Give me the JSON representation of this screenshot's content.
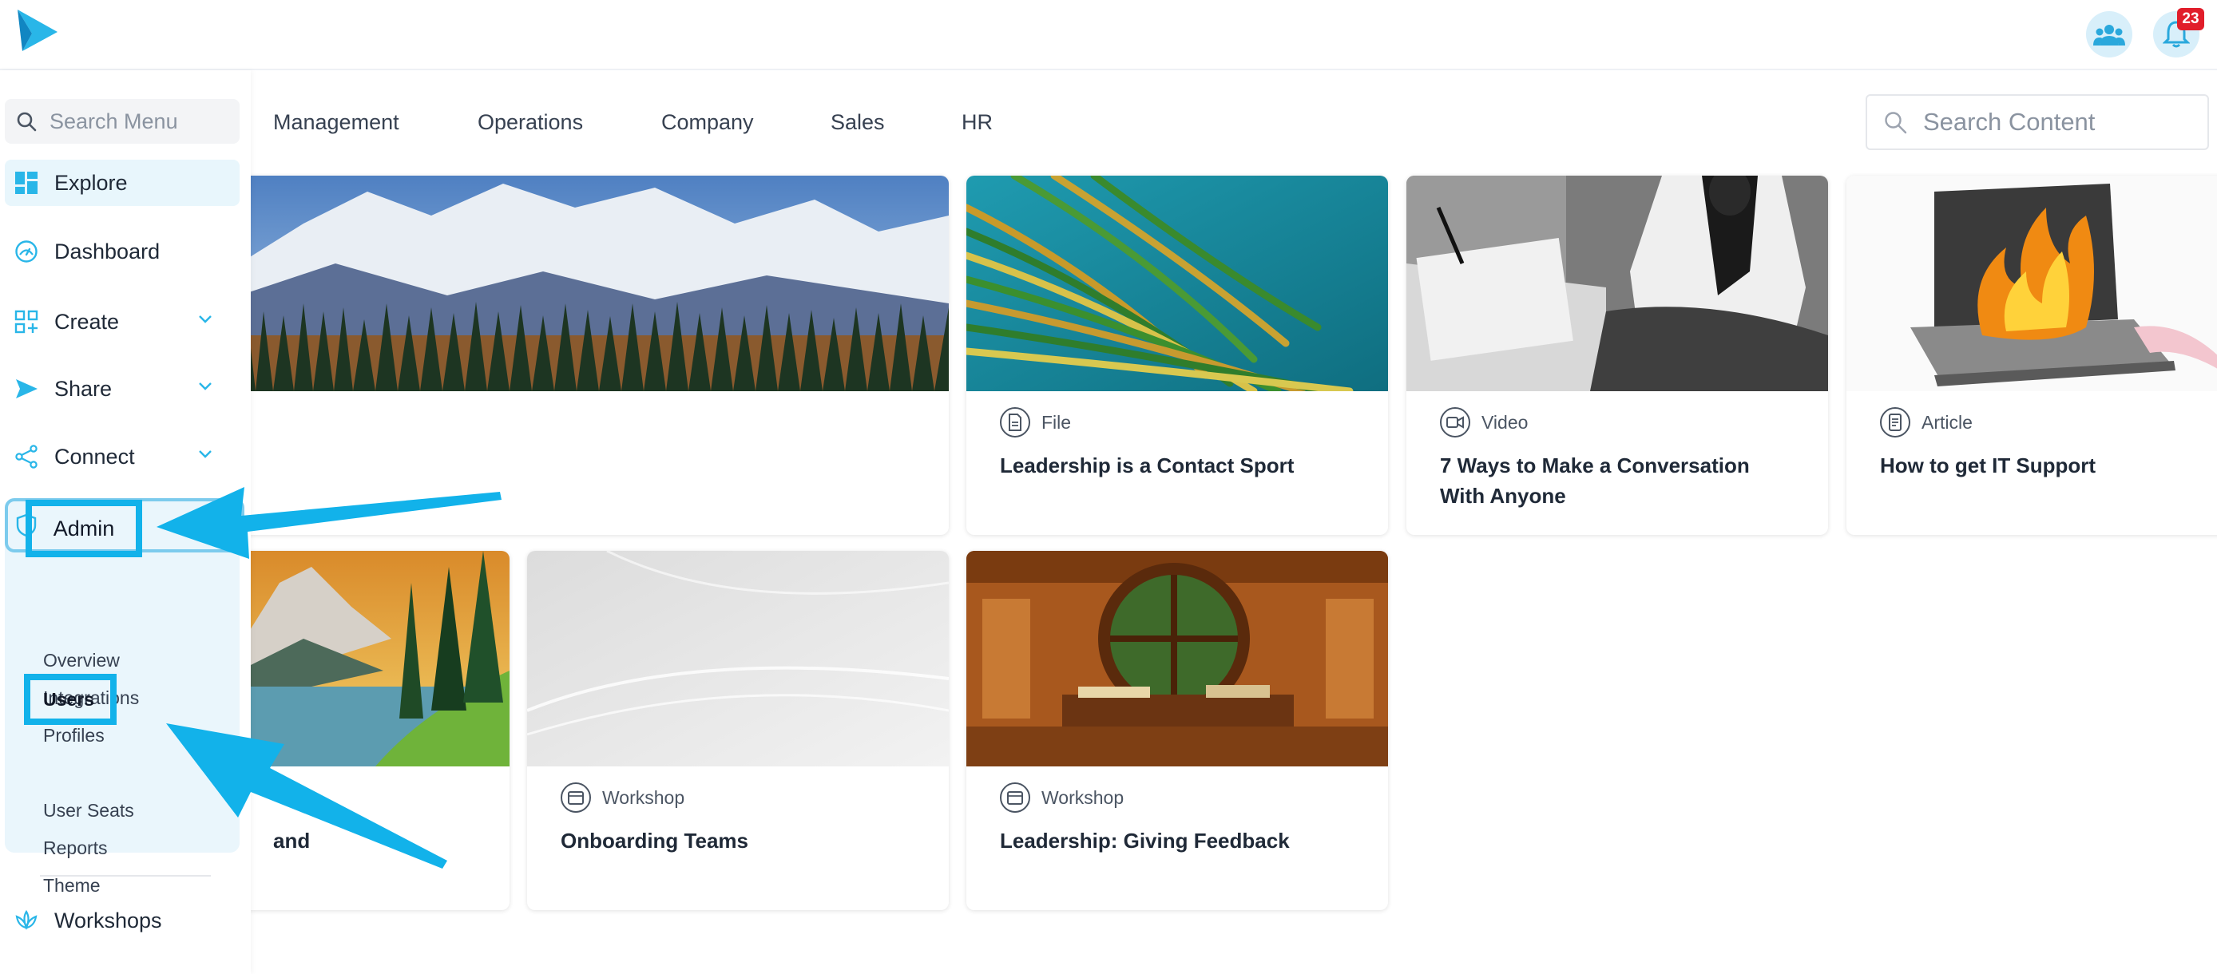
{
  "header": {
    "notification_count": "23"
  },
  "sidebar": {
    "search_placeholder": "Search Menu",
    "items": [
      {
        "label": "Explore"
      },
      {
        "label": "Dashboard"
      },
      {
        "label": "Create"
      },
      {
        "label": "Share"
      },
      {
        "label": "Connect"
      },
      {
        "label": "Admin"
      },
      {
        "label": "Workshops"
      }
    ],
    "admin_subitems": [
      "Overview",
      "Integrations",
      "Profiles",
      "Users",
      "User Seats",
      "Reports",
      "Theme"
    ]
  },
  "categories": [
    "Management",
    "Operations",
    "Company",
    "Sales",
    "HR"
  ],
  "content_search_placeholder": "Search Content",
  "cards": [
    {
      "type": "",
      "title": ""
    },
    {
      "type": "File",
      "title": "Leadership is a Contact Sport"
    },
    {
      "type": "Video",
      "title": "7 Ways to Make a Conversation With Anyone"
    },
    {
      "type": "Article",
      "title": "How to get IT Support"
    },
    {
      "type": "",
      "title": "and"
    },
    {
      "type": "Workshop",
      "title": "Onboarding Teams"
    },
    {
      "type": "Workshop",
      "title": "Leadership: Giving Feedback"
    }
  ],
  "colors": {
    "accent": "#12b2ea",
    "highlight_bg": "#eaf6fc",
    "badge": "#e11d2a"
  }
}
